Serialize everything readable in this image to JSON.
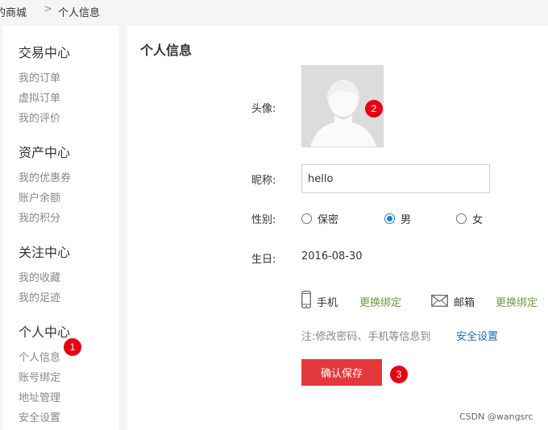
{
  "breadcrumb": {
    "home": "的商城",
    "separator": ">",
    "current": "个人信息"
  },
  "sidebar": {
    "groups": [
      {
        "title": "交易中心",
        "items": [
          "我的订单",
          "虚拟订单",
          "我的评价"
        ]
      },
      {
        "title": "资产中心",
        "items": [
          "我的优惠券",
          "账户余额",
          "我的积分"
        ]
      },
      {
        "title": "关注中心",
        "items": [
          "我的收藏",
          "我的足迹"
        ]
      },
      {
        "title": "个人中心",
        "items": [
          "个人信息",
          "账号绑定",
          "地址管理",
          "安全设置"
        ]
      }
    ]
  },
  "main": {
    "title": "个人信息",
    "avatar_label": "头像:",
    "nickname_label": "昵称:",
    "nickname_value": "hello",
    "gender_label": "性别:",
    "gender_options": [
      "保密",
      "男",
      "女"
    ],
    "gender_selected": "男",
    "birthday_label": "生日:",
    "birthday_value": "2016-08-30",
    "phone_label": "手机",
    "phone_link": "更换绑定",
    "email_label": "邮箱",
    "email_link": "更换绑定",
    "note": "注:修改密码、手机等信息到",
    "note_link": "安全设置",
    "save_label": "确认保存"
  },
  "badges": [
    "1",
    "2",
    "3"
  ],
  "watermark": "CSDN @wangsrc",
  "colors": {
    "accent_red": "#e4393c",
    "link_green": "#6a9a3a",
    "link_blue": "#1e6fa8",
    "radio_blue": "#1e82d7"
  },
  "icons": [
    "phone-icon",
    "mail-icon",
    "avatar-silhouette-icon"
  ]
}
